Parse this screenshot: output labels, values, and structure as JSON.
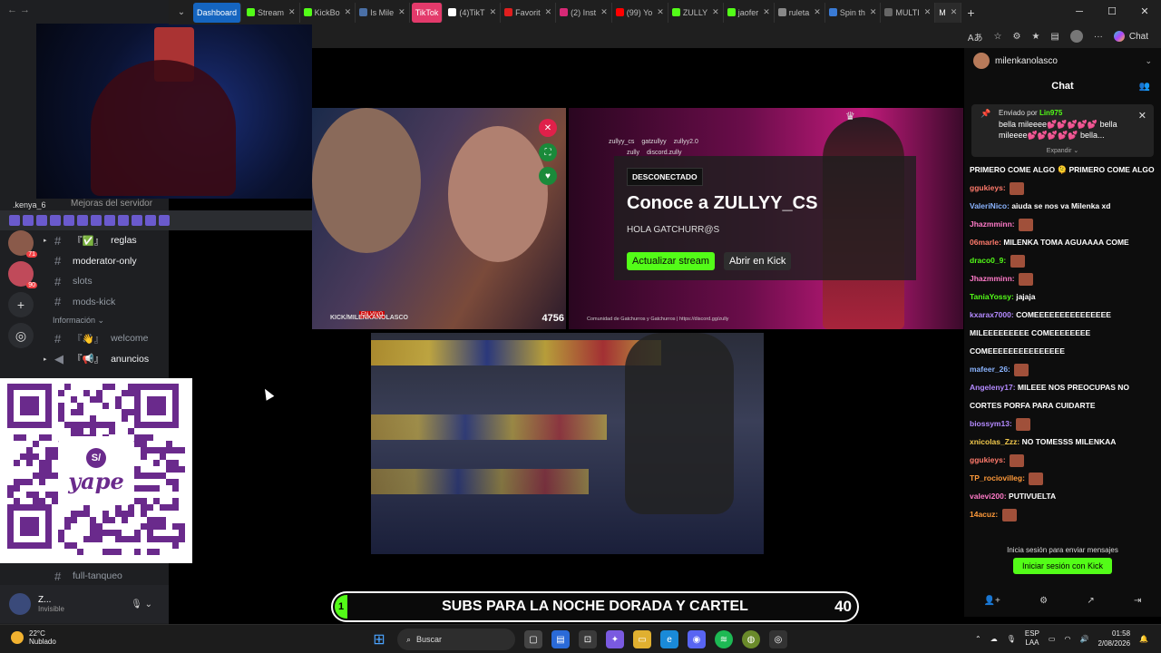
{
  "browser": {
    "tabs": [
      {
        "label": "Dashboard",
        "style": "dash",
        "color": "#1565c0"
      },
      {
        "label": "Stream",
        "color": "#53fc18"
      },
      {
        "label": "KickBo",
        "color": "#53fc18"
      },
      {
        "label": "Is Mile",
        "color": "#4a6fa5"
      },
      {
        "label": "TikTok",
        "style": "tiktokpill",
        "color": "#e33a6b"
      },
      {
        "label": "(4)TikT",
        "color": "#ffffff"
      },
      {
        "label": "Favorit",
        "color": "#e01e1e"
      },
      {
        "label": "(2) Inst",
        "color": "#d62976"
      },
      {
        "label": "(99) Yo",
        "color": "#ff0000"
      },
      {
        "label": "ZULLY",
        "color": "#53fc18"
      },
      {
        "label": "jaofer",
        "color": "#53fc18"
      },
      {
        "label": "ruleta",
        "color": "#888888"
      },
      {
        "label": "Spin th",
        "color": "#3a7bd5"
      },
      {
        "label": "MULTI",
        "color": "#666666"
      },
      {
        "label": "M",
        "style": "active",
        "color": "#53fc18"
      }
    ],
    "new_tab_icon": "plus-icon",
    "window_controls": [
      "minimize-icon",
      "maximize-icon",
      "close-icon"
    ],
    "copilot_label": "Chat"
  },
  "discord": {
    "user_tag": ".kenya_6",
    "best_server_label": "Mejoras del servidor",
    "server_badges": [
      "71",
      "90"
    ],
    "channels_top": [
      {
        "name": "reglas",
        "emoji": "『✅』",
        "bright": true,
        "caret": true
      },
      {
        "name": "moderator-only",
        "bright": true
      },
      {
        "name": "slots",
        "bright": false
      },
      {
        "name": "mods-kick",
        "bright": false
      }
    ],
    "category_info": "Información",
    "channels_info": [
      {
        "name": "welcome",
        "emoji": "『👋』",
        "bright": false
      },
      {
        "name": "anuncios",
        "emoji": "『📢』",
        "bright": true,
        "caret": true
      }
    ],
    "channel_bottom": "full-tanqueo",
    "user_panel": {
      "name": "Z...",
      "status": "Invisible"
    }
  },
  "tile_offline": {
    "badge": "DESCONECTADO",
    "title": "Conoce a ZULLYY_CS",
    "subtitle": "HOLA GATCHURR@S",
    "refresh_button": "Actualizar stream",
    "open_kick_button": "Abrir en Kick",
    "social_handles": [
      "zullyy_cs",
      "gatzullyy",
      "zullyy2.0"
    ],
    "social_handles_2": [
      "zully",
      "discord.zully"
    ],
    "community_text": "Comunidad de Gatchurros y Gatchurros  |  https://discord.gg/zully"
  },
  "tile_live": {
    "live_tag": "EN VIVO",
    "overlay_text": "KICK/MILENKANOLASCO",
    "viewer_count": "4756"
  },
  "goal_bar": {
    "start": "1",
    "text": "SUBS PARA LA NOCHE DORADA Y CARTEL",
    "goal": "40",
    "accent": "#53fc18"
  },
  "qr": {
    "brand": "yape",
    "logo_letter": "S/",
    "color": "#6a2a8c"
  },
  "chat": {
    "channel_name": "milenkanolasco",
    "title": "Chat",
    "pinned": {
      "sent_by_label": "Enviado por",
      "sender": "Lin975",
      "message": "bella mileeee💕💕💕💕💕 bella mileeee💕💕💕💕💕 bella...",
      "expand": "Expandir"
    },
    "messages": [
      {
        "user": "",
        "text": "PRIMERO COME ALGO 🫠 PRIMERO COME ALGO 🫠",
        "color": "#ffffff"
      },
      {
        "user": "ggukieys:",
        "text": "",
        "emote": true,
        "color": "#ff7a6b"
      },
      {
        "user": "ValeriNico:",
        "text": "aiuda se nos va Milenka xd",
        "color": "#8ab4ff"
      },
      {
        "user": "Jhazmminn:",
        "text": "",
        "emote": true,
        "color": "#ff7ac8"
      },
      {
        "user": "06marle:",
        "text": "MILENKA TOMA AGUAAAA COME",
        "color": "#ff7a6b"
      },
      {
        "user": "draco0_9:",
        "text": "",
        "emote": true,
        "color": "#53fc18"
      },
      {
        "user": "Jhazmminn:",
        "text": "",
        "emote": true,
        "color": "#ff7ac8"
      },
      {
        "user": "TaniaYossy:",
        "text": "jajaja",
        "color": "#53fc18"
      },
      {
        "user": "kxarax7000:",
        "text": "COMEEEEEEEEEEEEEEE",
        "color": "#b48aff"
      },
      {
        "user": "",
        "text": "MILEEEEEEEEE COMEEEEEEEE",
        "color": "#ffffff"
      },
      {
        "user": "",
        "text": "COMEEEEEEEEEEEEEEE",
        "color": "#ffffff"
      },
      {
        "user": "mafeer_26:",
        "text": "",
        "emote": true,
        "color": "#8ab4ff"
      },
      {
        "user": "Angeleny17:",
        "text": "MILEEE NOS PREOCUPAS NO",
        "color": "#b48aff"
      },
      {
        "user": "",
        "text": "CORTES PORFA PARA CUIDARTE",
        "color": "#ffffff"
      },
      {
        "user": "biossym13:",
        "text": "",
        "emote": true,
        "color": "#b48aff"
      },
      {
        "user": "xnicolas_Zzz:",
        "text": "NO TOMESSS MILENKAA",
        "color": "#f2c94c"
      },
      {
        "user": "ggukieys:",
        "text": "",
        "emote": true,
        "color": "#ff7a6b"
      },
      {
        "user": "TP_rociovilleg:",
        "text": "",
        "emote": true,
        "color": "#ff9a3a"
      },
      {
        "user": "valevi200:",
        "text": "PUTIVUELTA",
        "color": "#ff7ac8"
      },
      {
        "user": "14acuz:",
        "text": "",
        "emote": true,
        "color": "#ff9a3a"
      }
    ],
    "login_hint": "Inicia sesión para enviar mensajes",
    "login_button": "Iniciar sesión con Kick"
  },
  "taskbar": {
    "weather_temp": "22°C",
    "weather_desc": "Nublado",
    "search_placeholder": "Buscar",
    "lang_top": "ESP",
    "lang_bottom": "LAA",
    "time": "01:58",
    "date": "2/08/2026"
  }
}
